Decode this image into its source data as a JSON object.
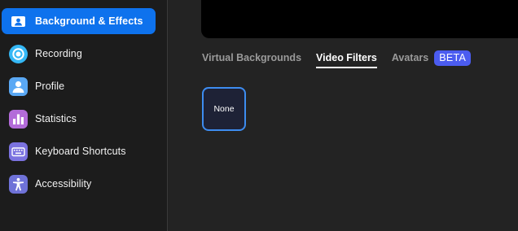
{
  "sidebar": {
    "items": [
      {
        "label": "Background & Effects",
        "icon": "background-effects-icon",
        "active": true,
        "icon_color": "#ffffff"
      },
      {
        "label": "Recording",
        "icon": "recording-icon",
        "active": false,
        "icon_color": "#35b8f5"
      },
      {
        "label": "Profile",
        "icon": "profile-icon",
        "active": false,
        "icon_color": "#5aa8f4"
      },
      {
        "label": "Statistics",
        "icon": "statistics-icon",
        "active": false,
        "icon_color": "#b36bd9"
      },
      {
        "label": "Keyboard Shortcuts",
        "icon": "keyboard-icon",
        "active": false,
        "icon_color": "#7b72e0"
      },
      {
        "label": "Accessibility",
        "icon": "accessibility-icon",
        "active": false,
        "icon_color": "#6f72d8"
      }
    ]
  },
  "main": {
    "tabs": [
      {
        "label": "Virtual Backgrounds",
        "active": false
      },
      {
        "label": "Video Filters",
        "active": true
      },
      {
        "label": "Avatars",
        "active": false,
        "badge": "BETA"
      }
    ],
    "filters": [
      {
        "label": "None",
        "selected": true
      }
    ]
  },
  "colors": {
    "accent": "#0e72ed",
    "beta_badge": "#4b5cf0",
    "selected_border": "#3d8cf0"
  }
}
